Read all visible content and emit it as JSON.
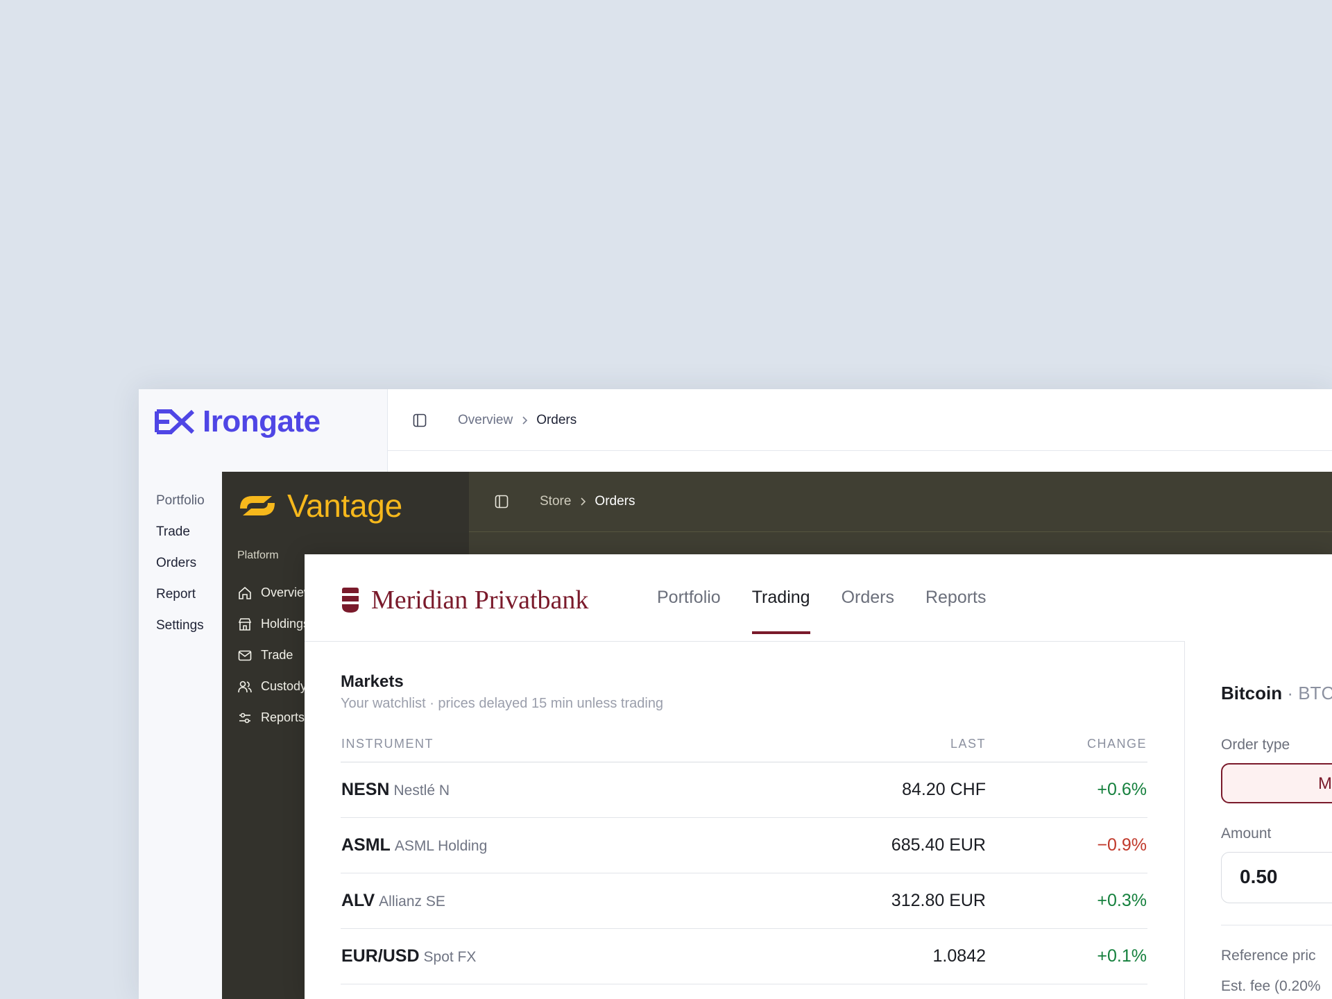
{
  "irongate": {
    "brand": "Irongate",
    "nav": [
      "Portfolio",
      "Trade",
      "Orders",
      "Report",
      "Settings"
    ],
    "breadcrumb": [
      "Overview",
      "Orders"
    ],
    "accent": "#4f46e5"
  },
  "vantage": {
    "brand": "Vantage",
    "section": "Platform",
    "nav": [
      "Overview",
      "Holdings",
      "Trade",
      "Custody",
      "Reports"
    ],
    "breadcrumb": [
      "Store",
      "Orders"
    ],
    "accent": "#f6b81c"
  },
  "meridian": {
    "brand": "Meridian Privatbank",
    "accent": "#7a1a2b",
    "tabs": [
      "Portfolio",
      "Trading",
      "Orders",
      "Reports"
    ],
    "active_tab": "Trading",
    "markets": {
      "title": "Markets",
      "subtitle": "Your watchlist · prices delayed 15 min unless trading",
      "columns": [
        "INSTRUMENT",
        "LAST",
        "CHANGE"
      ],
      "rows": [
        {
          "symbol": "NESN",
          "name": "Nestlé N",
          "last": "84.20 CHF",
          "change": "+0.6%",
          "direction": "up"
        },
        {
          "symbol": "ASML",
          "name": "ASML Holding",
          "last": "685.40 EUR",
          "change": "−0.9%",
          "direction": "down"
        },
        {
          "symbol": "ALV",
          "name": "Allianz SE",
          "last": "312.80 EUR",
          "change": "+0.3%",
          "direction": "up"
        },
        {
          "symbol": "EUR/USD",
          "name": "Spot FX",
          "last": "1.0842",
          "change": "+0.1%",
          "direction": "up"
        }
      ]
    },
    "order": {
      "title_bold": "Bitcoin",
      "title_rest": " · BTC",
      "order_type_label": "Order type",
      "order_type_value": "M",
      "amount_label": "Amount",
      "amount_value": "0.50",
      "ref_label": "Reference pric",
      "fee_label": "Est. fee (0.20%"
    }
  }
}
